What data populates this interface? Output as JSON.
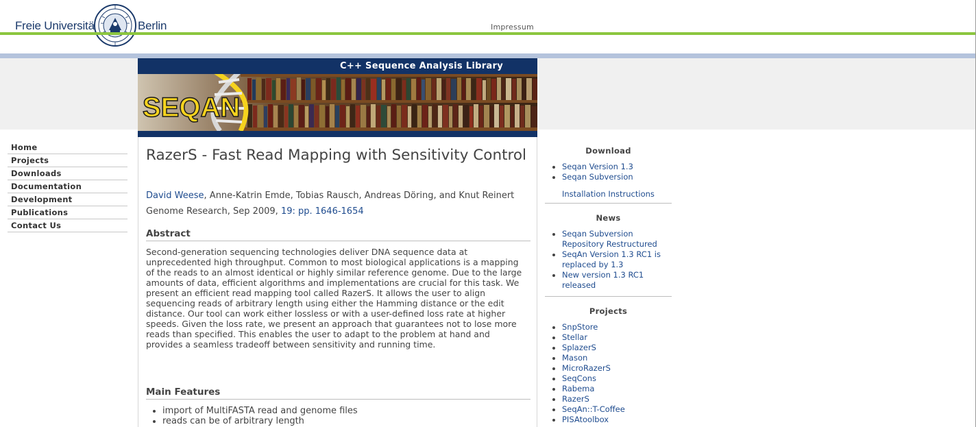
{
  "header": {
    "uni_left": "Freie Universität",
    "uni_right": "Berlin",
    "impressum": "Impressum"
  },
  "banner": {
    "title": "C++ Sequence Analysis Library",
    "logo_text": "SEQAN"
  },
  "nav": {
    "items": [
      {
        "label": "Home"
      },
      {
        "label": "Projects"
      },
      {
        "label": "Downloads"
      },
      {
        "label": "Documentation"
      },
      {
        "label": "Development"
      },
      {
        "label": "Publications"
      },
      {
        "label": "Contact Us"
      }
    ]
  },
  "article": {
    "title": "RazerS - Fast Read Mapping with Sensitivity Control",
    "author_link": "David Weese",
    "authors_rest": ", Anne-Katrin Emde, Tobias Rausch, Andreas Döring, and Knut Reinert",
    "journal": "Genome Research, Sep 2009, ",
    "pages_link": "19: pp. 1646-1654",
    "abstract_heading": "Abstract",
    "abstract": "Second-generation sequencing technologies deliver DNA sequence data at unprecedented high throughput. Common to most biological applications is a mapping of the reads to an almost identical or highly similar reference genome. Due to the large amounts of data, efficient algorithms and implementations are crucial for this task. We present an efficient read mapping tool called RazerS. It allows the user to align sequencing reads of arbitrary length using either the Hamming distance or the edit distance. Our tool can work either lossless or with a user-defined loss rate at higher speeds. Given the loss rate, we present an approach that guarantees not to lose more reads than specified. This enables the user to adapt to the problem at hand and provides a seamless tradeoff between sensitivity and running time.",
    "features_heading": "Main Features",
    "features": [
      "import of MultiFASTA read and genome files",
      "reads can be of arbitrary length"
    ]
  },
  "sidebar": {
    "download": {
      "heading": "Download",
      "items": [
        "Seqan Version 1.3",
        "Seqan Subversion"
      ],
      "extra_link": "Installation Instructions"
    },
    "news": {
      "heading": "News",
      "items": [
        "Seqan Subversion Repository Restructured",
        "SeqAn Version 1.3 RC1 is replaced by 1.3",
        "New version 1.3 RC1 released"
      ]
    },
    "projects": {
      "heading": "Projects",
      "items": [
        "SnpStore",
        "Stellar",
        "SplazerS",
        "Mason",
        "MicroRazerS",
        "SeqCons",
        "Rabema",
        "RazerS",
        "SeqAn::T-Coffee",
        "PISAtoolbox"
      ]
    }
  },
  "colors": {
    "fu_blue": "#1b3a6b",
    "fu_green": "#8cc63f",
    "banner_blue": "#123266",
    "link": "#1f4c8f",
    "logo_yellow": "#f5d21e"
  }
}
